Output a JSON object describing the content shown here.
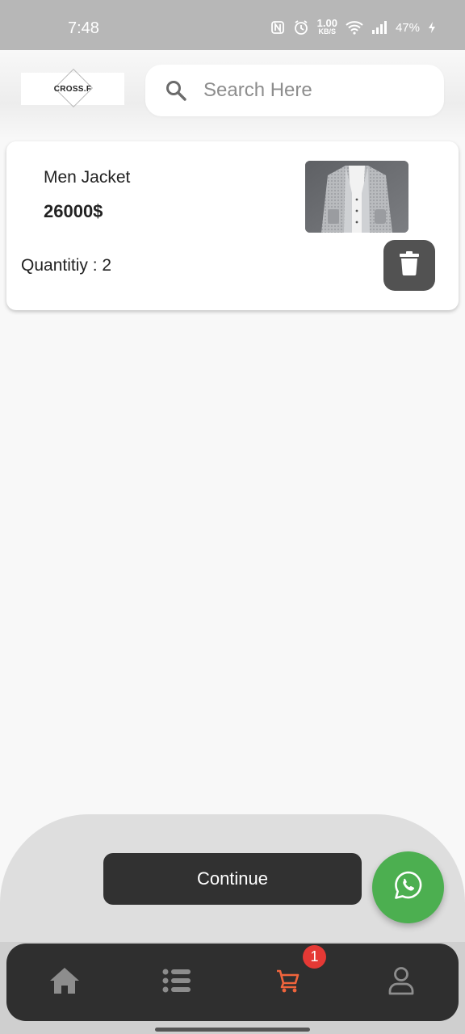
{
  "status_bar": {
    "time": "7:48",
    "net_speed_value": "1.00",
    "net_speed_unit": "KB/S",
    "battery": "47%",
    "icons": [
      "nfc-icon",
      "alarm-icon",
      "wifi-icon",
      "signal-icon",
      "charging-icon"
    ]
  },
  "header": {
    "logo_text": "CROSS.F",
    "search": {
      "placeholder": "Search Here",
      "value": ""
    }
  },
  "cart": {
    "items": [
      {
        "name": "Men Jacket",
        "price": "26000$",
        "quantity_text": "Quantitiy : 2"
      }
    ]
  },
  "actions": {
    "continue_label": "Continue"
  },
  "nav": {
    "items": [
      "home-icon",
      "list-icon",
      "cart-icon",
      "profile-icon"
    ],
    "active": "cart-icon",
    "cart_badge": "1"
  },
  "colors": {
    "accent": "#f0643c",
    "whatsapp": "#4caf50",
    "badge": "#e53935",
    "dark": "#313131"
  }
}
